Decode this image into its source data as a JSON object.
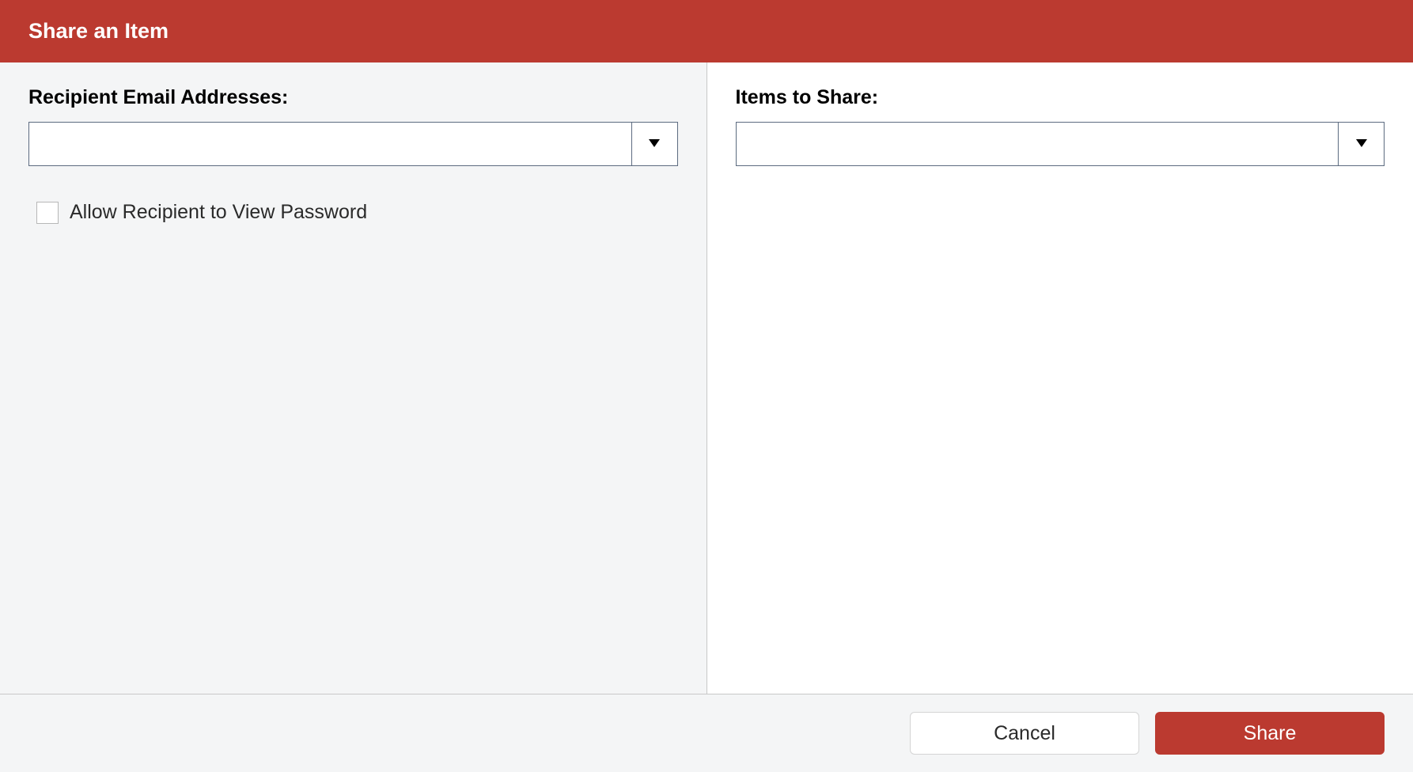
{
  "header": {
    "title": "Share an Item"
  },
  "left": {
    "recipient_label": "Recipient Email Addresses:",
    "recipient_value": "",
    "allow_view_password_label": "Allow Recipient to View Password",
    "allow_view_password_checked": false
  },
  "right": {
    "items_label": "Items to Share:",
    "items_value": ""
  },
  "footer": {
    "cancel_label": "Cancel",
    "share_label": "Share"
  },
  "colors": {
    "accent": "#bb3a30",
    "panel_left_bg": "#f4f5f6",
    "panel_right_bg": "#ffffff",
    "border": "#5c6b80"
  }
}
